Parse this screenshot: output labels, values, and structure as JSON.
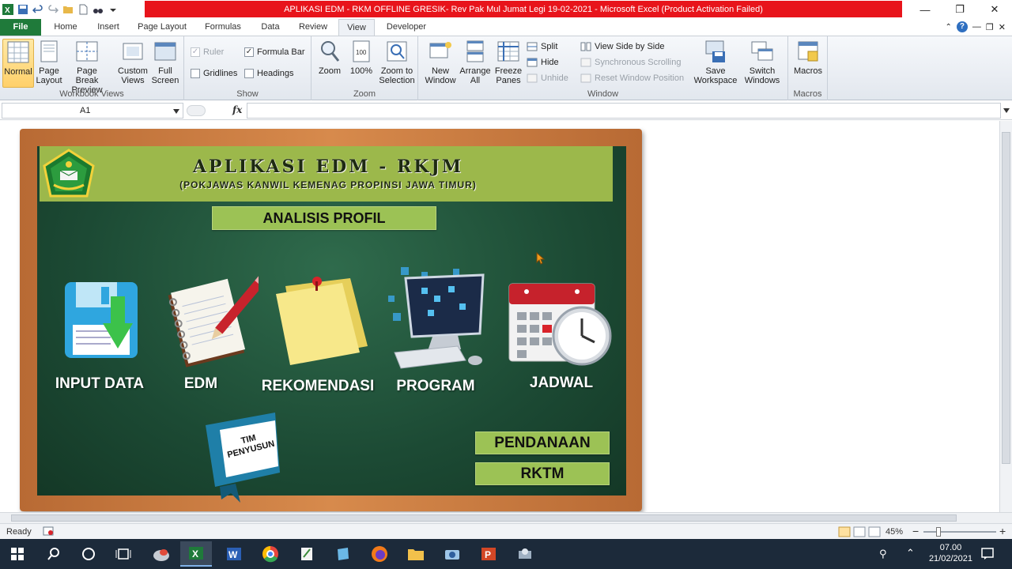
{
  "window": {
    "title": "APLIKASI EDM - RKM OFFLINE GRESIK- Rev Pak Mul Jumat Legi 19-02-2021 - Microsoft Excel (Product Activation Failed)"
  },
  "tabs": [
    "File",
    "Home",
    "Insert",
    "Page Layout",
    "Formulas",
    "Data",
    "Review",
    "View",
    "Developer"
  ],
  "ribbon": {
    "workbook_views": {
      "label": "Workbook Views",
      "normal": "Normal",
      "page_layout": [
        "Page",
        "Layout"
      ],
      "page_break": [
        "Page Break",
        "Preview"
      ],
      "custom_views": [
        "Custom",
        "Views"
      ],
      "full_screen": [
        "Full",
        "Screen"
      ]
    },
    "show": {
      "label": "Show",
      "ruler": "Ruler",
      "formula_bar": "Formula Bar",
      "gridlines": "Gridlines",
      "headings": "Headings"
    },
    "zoom": {
      "label": "Zoom",
      "zoom": "Zoom",
      "hundred": "100%",
      "zoom_to_selection": [
        "Zoom to",
        "Selection"
      ]
    },
    "window": {
      "label": "Window",
      "new_window": [
        "New",
        "Window"
      ],
      "arrange_all": [
        "Arrange",
        "All"
      ],
      "freeze_panes": [
        "Freeze",
        "Panes"
      ],
      "split": "Split",
      "hide": "Hide",
      "unhide": "Unhide",
      "view_side_by_side": "View Side by Side",
      "sync_scrolling": "Synchronous Scrolling",
      "reset_window_position": "Reset Window Position",
      "save_workspace": [
        "Save",
        "Workspace"
      ],
      "switch_windows": [
        "Switch",
        "Windows"
      ]
    },
    "macros": {
      "label": "Macros",
      "macros": "Macros"
    }
  },
  "formula_bar": {
    "name_box": "A1",
    "fx": "fx",
    "value": ""
  },
  "board": {
    "title": "APLIKASI EDM - RKJM",
    "subtitle": "(POKJAWAS KANWIL KEMENAG PROPINSI JAWA TIMUR)",
    "section": "ANALISIS PROFIL",
    "items": [
      {
        "label": "INPUT DATA",
        "icon": "floppy-download-icon"
      },
      {
        "label": "EDM",
        "icon": "notebook-pencil-icon"
      },
      {
        "label": "REKOMENDASI",
        "icon": "sticky-note-icon"
      },
      {
        "label": "PROGRAM",
        "icon": "computer-icon"
      },
      {
        "label": "JADWAL",
        "icon": "calendar-clock-icon"
      }
    ],
    "tim_penyusun": [
      "TIM",
      "PENYUSUN"
    ],
    "pendanaan": "PENDANAAN",
    "rktm": "RKTM"
  },
  "status_bar": {
    "ready": "Ready",
    "zoom": "45%"
  },
  "taskbar": {
    "time": "07.00",
    "date": "21/02/2021"
  },
  "colors": {
    "title_red": "#e8141b",
    "file_tab": "#1f7a3a",
    "banner_green": "#9cb84b",
    "board_green": "#1c4a34",
    "frame_wood": "#c97a3f"
  }
}
